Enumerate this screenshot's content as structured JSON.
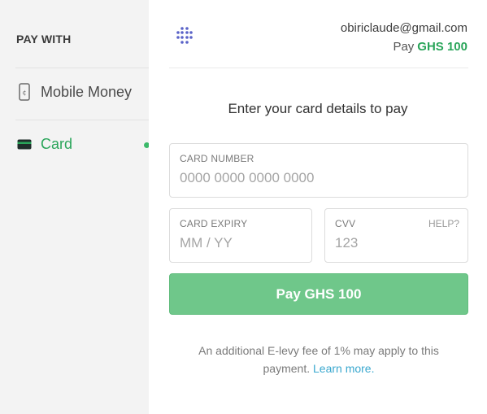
{
  "sidebar": {
    "title": "PAY WITH",
    "items": [
      {
        "label": "Mobile Money",
        "icon": "mobile-phone-icon",
        "active": false
      },
      {
        "label": "Card",
        "icon": "credit-card-icon",
        "active": true
      }
    ]
  },
  "header": {
    "logo": "merchant-logo-icon",
    "email": "obiriclaude@gmail.com",
    "pay_prefix": "Pay",
    "amount": "GHS 100"
  },
  "form": {
    "heading": "Enter your card details to pay",
    "card_number": {
      "label": "CARD NUMBER",
      "placeholder": "0000 0000 0000 0000",
      "value": ""
    },
    "card_expiry": {
      "label": "CARD EXPIRY",
      "placeholder": "MM / YY",
      "value": ""
    },
    "cvv": {
      "label": "CVV",
      "placeholder": "123",
      "value": "",
      "help": "HELP?"
    },
    "pay_button": "Pay GHS 100"
  },
  "note": {
    "text": "An additional E-levy fee of 1% may apply to this payment.",
    "link": "Learn more."
  },
  "colors": {
    "accent_green": "#2aa55a",
    "button_green": "#6fc78a",
    "link_blue": "#3aa8cf",
    "sidebar_bg": "#f3f3f3"
  }
}
